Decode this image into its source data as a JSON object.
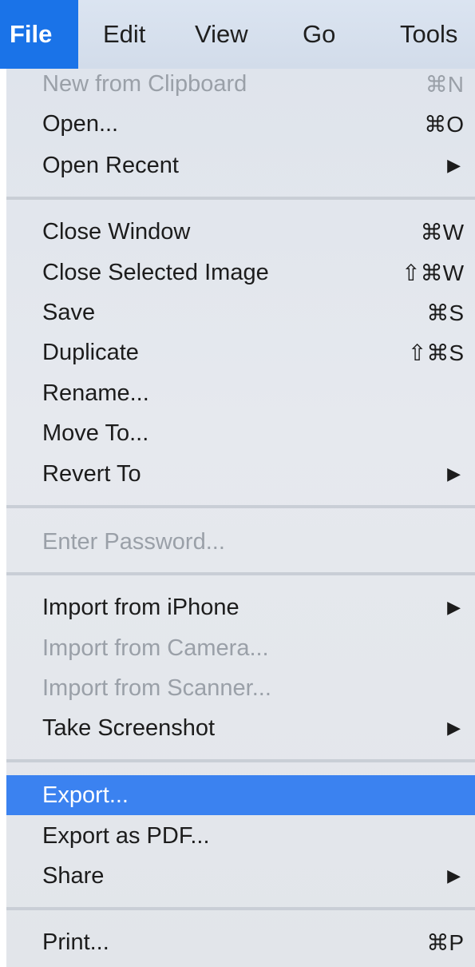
{
  "menubar": {
    "items": [
      {
        "label": "File"
      },
      {
        "label": "Edit"
      },
      {
        "label": "View"
      },
      {
        "label": "Go"
      },
      {
        "label": "Tools"
      }
    ]
  },
  "menu": {
    "items": [
      {
        "label": "New from Clipboard",
        "shortcut": "⌘N",
        "disabled": true
      },
      {
        "label": "Open...",
        "shortcut": "⌘O"
      },
      {
        "label": "Open Recent",
        "shortcut": "▶"
      },
      {
        "label": "Close Window",
        "shortcut": "⌘W"
      },
      {
        "label": "Close Selected Image",
        "shortcut": "⇧⌘W"
      },
      {
        "label": "Save",
        "shortcut": "⌘S"
      },
      {
        "label": "Duplicate",
        "shortcut": "⇧⌘S"
      },
      {
        "label": "Rename..."
      },
      {
        "label": "Move To..."
      },
      {
        "label": "Revert To",
        "shortcut": "▶"
      },
      {
        "label": "Enter Password...",
        "disabled": true
      },
      {
        "label": "Import from iPhone",
        "shortcut": "▶"
      },
      {
        "label": "Import from Camera...",
        "disabled": true
      },
      {
        "label": "Import from Scanner...",
        "disabled": true
      },
      {
        "label": "Take Screenshot",
        "shortcut": "▶"
      },
      {
        "label": "Export...",
        "highlighted": true
      },
      {
        "label": "Export as PDF..."
      },
      {
        "label": "Share",
        "shortcut": "▶"
      },
      {
        "label": "Print...",
        "shortcut": "⌘P"
      }
    ]
  },
  "colors": {
    "highlight": "#3b82f0",
    "active_menu": "#1a73e8"
  }
}
